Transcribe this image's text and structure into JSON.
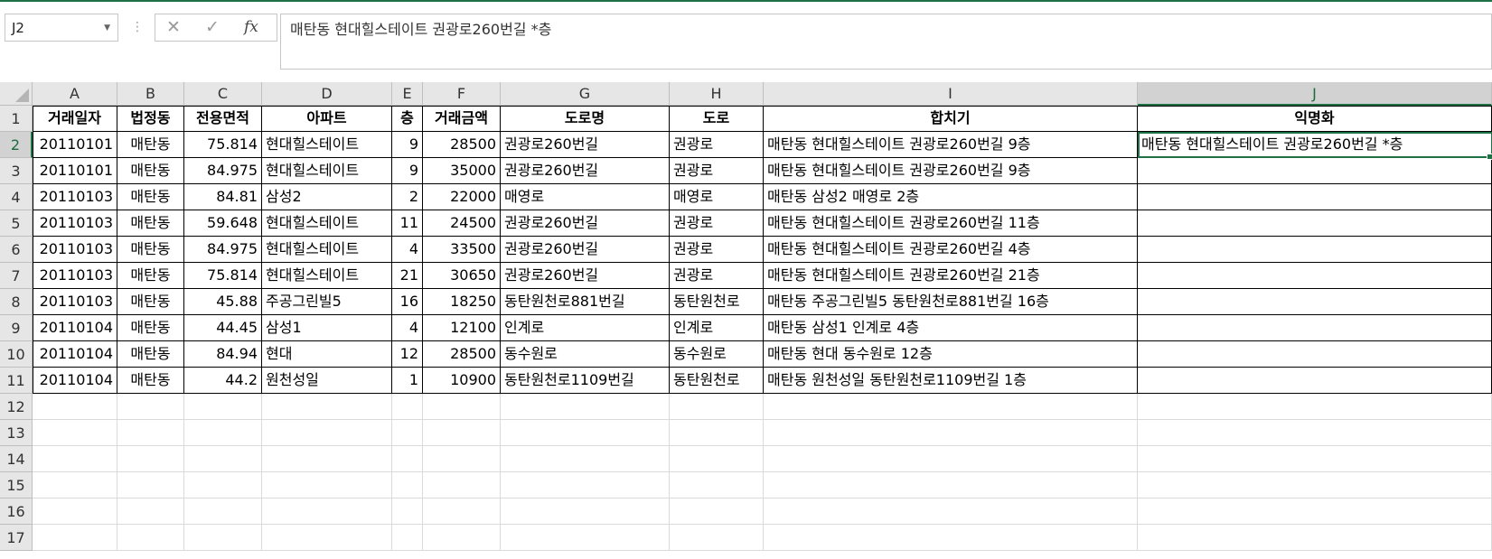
{
  "name_box": {
    "value": "J2"
  },
  "formula_bar": {
    "cancel_icon": "✕",
    "enter_icon": "✓",
    "fx_label": "fx",
    "content": "매탄동 현대힐스테이트 권광로260번길 *층"
  },
  "columns": [
    "A",
    "B",
    "C",
    "D",
    "E",
    "F",
    "G",
    "H",
    "I",
    "J"
  ],
  "rows": [
    "1",
    "2",
    "3",
    "4",
    "5",
    "6",
    "7",
    "8",
    "9",
    "10",
    "11",
    "12",
    "13",
    "14",
    "15",
    "16",
    "17"
  ],
  "selected_cell": "J2",
  "headers": [
    "거래일자",
    "법정동",
    "전용면적",
    "아파트",
    "층",
    "거래금액",
    "도로명",
    "도로",
    "합치기",
    "익명화"
  ],
  "data_rows": [
    [
      "20110101",
      "매탄동",
      "75.814",
      "현대힐스테이트",
      "9",
      "28500",
      "권광로260번길",
      "권광로",
      "매탄동 현대힐스테이트 권광로260번길 9층",
      "매탄동 현대힐스테이트 권광로260번길 *층"
    ],
    [
      "20110101",
      "매탄동",
      "84.975",
      "현대힐스테이트",
      "9",
      "35000",
      "권광로260번길",
      "권광로",
      "매탄동 현대힐스테이트 권광로260번길 9층",
      ""
    ],
    [
      "20110103",
      "매탄동",
      "84.81",
      "삼성2",
      "2",
      "22000",
      "매영로",
      "매영로",
      "매탄동 삼성2 매영로 2층",
      ""
    ],
    [
      "20110103",
      "매탄동",
      "59.648",
      "현대힐스테이트",
      "11",
      "24500",
      "권광로260번길",
      "권광로",
      "매탄동 현대힐스테이트 권광로260번길 11층",
      ""
    ],
    [
      "20110103",
      "매탄동",
      "84.975",
      "현대힐스테이트",
      "4",
      "33500",
      "권광로260번길",
      "권광로",
      "매탄동 현대힐스테이트 권광로260번길 4층",
      ""
    ],
    [
      "20110103",
      "매탄동",
      "75.814",
      "현대힐스테이트",
      "21",
      "30650",
      "권광로260번길",
      "권광로",
      "매탄동 현대힐스테이트 권광로260번길 21층",
      ""
    ],
    [
      "20110103",
      "매탄동",
      "45.88",
      "주공그린빌5",
      "16",
      "18250",
      "동탄원천로881번길",
      "동탄원천로",
      "매탄동 주공그린빌5 동탄원천로881번길 16층",
      ""
    ],
    [
      "20110104",
      "매탄동",
      "44.45",
      "삼성1",
      "4",
      "12100",
      "인계로",
      "인계로",
      "매탄동 삼성1 인계로 4층",
      ""
    ],
    [
      "20110104",
      "매탄동",
      "84.94",
      "현대",
      "12",
      "28500",
      "동수원로",
      "동수원로",
      "매탄동 현대 동수원로 12층",
      ""
    ],
    [
      "20110104",
      "매탄동",
      "44.2",
      "원천성일",
      "1",
      "10900",
      "동탄원천로1109번길",
      "동탄원천로",
      "매탄동 원천성일 동탄원천로1109번길 1층",
      ""
    ]
  ],
  "colors": {
    "accent": "#1e7145",
    "header_bg": "#e6e6e6",
    "gridline": "#dadada"
  }
}
